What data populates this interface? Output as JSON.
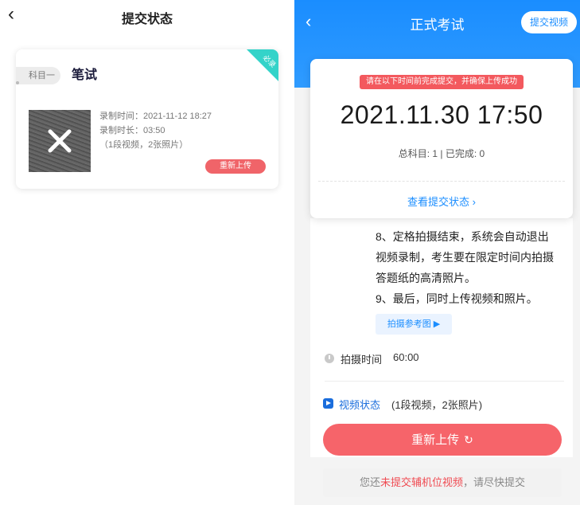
{
  "left": {
    "back_glyph": "‹",
    "title": "提交状态",
    "card": {
      "subject_tag": "科目一",
      "subject_name": "笔试",
      "corner_label": "必录",
      "record_time": "录制时间：2021-11-12 18:27",
      "record_duration": "录制时长：03:50",
      "media_count": "（1段视频，2张照片）",
      "reupload_label": "重新上传"
    }
  },
  "right": {
    "back_glyph": "‹",
    "title": "正式考试",
    "submit_video_label": "提交视频",
    "deadline": {
      "notice": "请在以下时间前完成提交，并确保上传成功",
      "time": "2021.11.30 17:50",
      "counts": "总科目: 1 | 已完成: 0",
      "view_status": "查看提交状态 ›"
    },
    "steps": [
      "8、定格拍摄结束，系统会自动退出视频录制，考生要在限定时间内拍摄答题纸的高清照片。",
      "9、最后，同时上传视频和照片。"
    ],
    "reference_btn": "拍摄参考图 ▶",
    "shoot_time_label": "拍摄时间",
    "shoot_time_value": "60:00",
    "video_status_label": "视频状态",
    "video_status_value": "(1段视频，2张照片)",
    "reupload_label": "重新上传",
    "reupload_icon": "↻",
    "warning": {
      "prefix": "您还",
      "highlight": "未提交辅机位视频",
      "suffix": "，请尽快提交"
    },
    "colors": {
      "primary_blue": "#1a8dff",
      "danger_red": "#f6646a",
      "corner_teal": "#34d3c9"
    }
  }
}
